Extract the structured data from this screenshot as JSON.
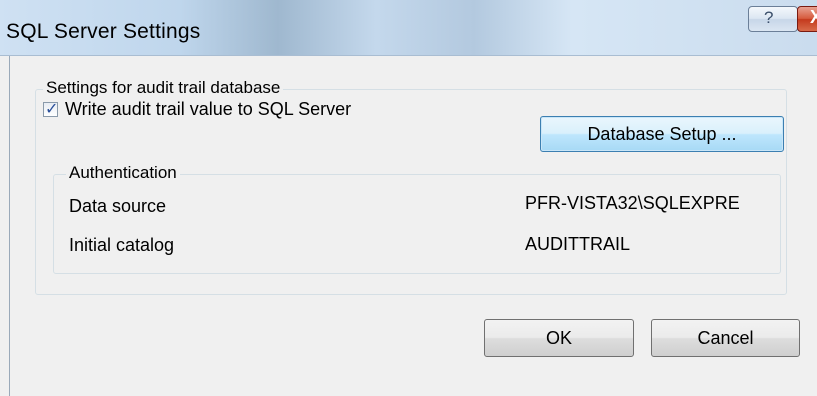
{
  "window": {
    "title": "SQL Server Settings",
    "help_glyph": "?",
    "close_glyph": "X"
  },
  "settings_group": {
    "legend": "Settings for audit trail database",
    "checkbox": {
      "label": "Write audit trail value to SQL Server",
      "checked": true
    },
    "database_setup_label": "Database Setup ..."
  },
  "authentication": {
    "legend": "Authentication",
    "data_source_label": "Data source",
    "data_source_value": "PFR-VISTA32\\SQLEXPRE",
    "initial_catalog_label": "Initial catalog",
    "initial_catalog_value": "AUDITTRAIL"
  },
  "buttons": {
    "ok_label": "OK",
    "cancel_label": "Cancel"
  },
  "colors": {
    "close_button": "#c43a1d",
    "focused_button_border": "#3c7fb1",
    "checkmark": "#2a4f9a"
  }
}
